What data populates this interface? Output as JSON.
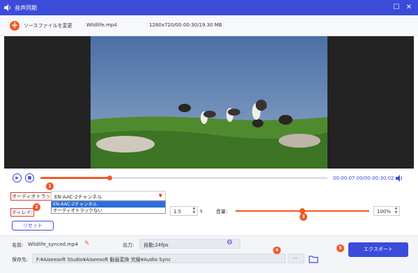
{
  "window": {
    "title": "音声同期",
    "minimize_icon": "square-icon",
    "close_icon": "close-icon"
  },
  "file": {
    "change_label": "ソースファイルを変更",
    "name": "Wildlife.mp4",
    "info": "1280x720/00:00:30/19.30 MB"
  },
  "player": {
    "current_time": "00:00:07.00",
    "separator": "/",
    "total_time": "00:00:30.02",
    "progress_fraction": 0.24
  },
  "audio_track": {
    "label": "オーディオトラック:",
    "selected": "EN-AAC-2チャンネル",
    "options": [
      "EN-AAC-2チャンネル",
      "オーディオトラックない"
    ]
  },
  "delay": {
    "label": "ディレイ:",
    "value": "1.5",
    "unit": "s"
  },
  "volume": {
    "label": "音量:",
    "value": "100%",
    "level_fraction": 0.5
  },
  "reset_label": "リセット",
  "output": {
    "name_label": "名前:",
    "name_value": "Wildlife_synced.mp4",
    "format_label": "出力:",
    "format_value": "自動;24fps",
    "save_label": "保存先:",
    "save_path": "F:¥Aiseesoft Studio¥Aiseesoft 動画変換 究極¥Audio Sync",
    "browse_label": "···",
    "export_label": "エクスポート"
  },
  "badges": [
    "1",
    "2",
    "3",
    "4",
    "5"
  ],
  "colors": {
    "accent": "#3b4cd9",
    "highlight": "#f05a28",
    "annotation": "#e43535"
  }
}
